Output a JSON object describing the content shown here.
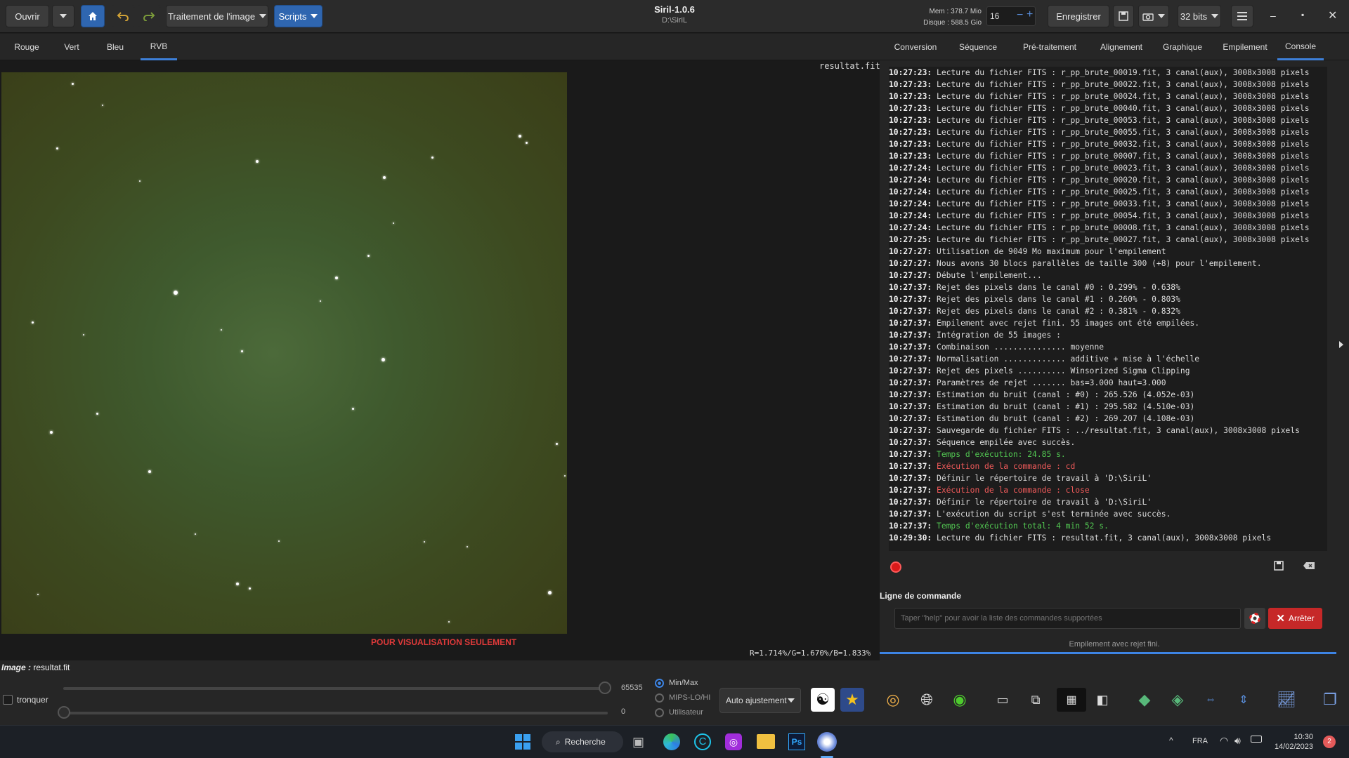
{
  "header": {
    "open_label": "Ouvrir",
    "image_processing_label": "Traitement de l'image",
    "scripts_label": "Scripts",
    "app_title": "Siril-1.0.6",
    "working_dir": "D:\\SiriL",
    "mem": "Mem : 378.7 Mio",
    "disk": "Disque : 588.5 Gio",
    "threads": "16",
    "save_label": "Enregistrer",
    "bits_label": "32 bits"
  },
  "channel_tabs": [
    "Rouge",
    "Vert",
    "Bleu",
    "RVB"
  ],
  "right_tabs": [
    "Conversion",
    "Séquence",
    "Pré-traitement",
    "Alignement",
    "Graphique",
    "Empilement",
    "Console"
  ],
  "image": {
    "filename": "resultat.fit",
    "preview_note": "POUR VISUALISATION SEULEMENT",
    "rgb_readout": "R=1.714%/G=1.670%/B=1.833%",
    "image_label_prefix": "Image :",
    "image_label_value": "resultat.fit"
  },
  "console": {
    "lines": [
      {
        "t": "10:27:23:",
        "m": "Lecture du fichier FITS : r_pp_brute_00019.fit, 3 canal(aux), 3008x3008 pixels",
        "c": ""
      },
      {
        "t": "10:27:23:",
        "m": "Lecture du fichier FITS : r_pp_brute_00022.fit, 3 canal(aux), 3008x3008 pixels",
        "c": ""
      },
      {
        "t": "10:27:23:",
        "m": "Lecture du fichier FITS : r_pp_brute_00024.fit, 3 canal(aux), 3008x3008 pixels",
        "c": ""
      },
      {
        "t": "10:27:23:",
        "m": "Lecture du fichier FITS : r_pp_brute_00040.fit, 3 canal(aux), 3008x3008 pixels",
        "c": ""
      },
      {
        "t": "10:27:23:",
        "m": "Lecture du fichier FITS : r_pp_brute_00053.fit, 3 canal(aux), 3008x3008 pixels",
        "c": ""
      },
      {
        "t": "10:27:23:",
        "m": "Lecture du fichier FITS : r_pp_brute_00055.fit, 3 canal(aux), 3008x3008 pixels",
        "c": ""
      },
      {
        "t": "10:27:23:",
        "m": "Lecture du fichier FITS : r_pp_brute_00032.fit, 3 canal(aux), 3008x3008 pixels",
        "c": ""
      },
      {
        "t": "10:27:23:",
        "m": "Lecture du fichier FITS : r_pp_brute_00007.fit, 3 canal(aux), 3008x3008 pixels",
        "c": ""
      },
      {
        "t": "10:27:24:",
        "m": "Lecture du fichier FITS : r_pp_brute_00023.fit, 3 canal(aux), 3008x3008 pixels",
        "c": ""
      },
      {
        "t": "10:27:24:",
        "m": "Lecture du fichier FITS : r_pp_brute_00020.fit, 3 canal(aux), 3008x3008 pixels",
        "c": ""
      },
      {
        "t": "10:27:24:",
        "m": "Lecture du fichier FITS : r_pp_brute_00025.fit, 3 canal(aux), 3008x3008 pixels",
        "c": ""
      },
      {
        "t": "10:27:24:",
        "m": "Lecture du fichier FITS : r_pp_brute_00033.fit, 3 canal(aux), 3008x3008 pixels",
        "c": ""
      },
      {
        "t": "10:27:24:",
        "m": "Lecture du fichier FITS : r_pp_brute_00054.fit, 3 canal(aux), 3008x3008 pixels",
        "c": ""
      },
      {
        "t": "10:27:24:",
        "m": "Lecture du fichier FITS : r_pp_brute_00008.fit, 3 canal(aux), 3008x3008 pixels",
        "c": ""
      },
      {
        "t": "10:27:25:",
        "m": "Lecture du fichier FITS : r_pp_brute_00027.fit, 3 canal(aux), 3008x3008 pixels",
        "c": ""
      },
      {
        "t": "10:27:27:",
        "m": "Utilisation de 9049 Mo maximum pour l'empilement",
        "c": ""
      },
      {
        "t": "10:27:27:",
        "m": "Nous avons 30 blocs parallèles de taille 300 (+8) pour l'empilement.",
        "c": ""
      },
      {
        "t": "10:27:27:",
        "m": "Débute l'empilement...",
        "c": ""
      },
      {
        "t": "10:27:37:",
        "m": "Rejet des pixels dans le canal #0 : 0.299% - 0.638%",
        "c": ""
      },
      {
        "t": "10:27:37:",
        "m": "Rejet des pixels dans le canal #1 : 0.260% - 0.803%",
        "c": ""
      },
      {
        "t": "10:27:37:",
        "m": "Rejet des pixels dans le canal #2 : 0.381% - 0.832%",
        "c": ""
      },
      {
        "t": "10:27:37:",
        "m": "Empilement avec rejet fini. 55 images ont été empilées.",
        "c": ""
      },
      {
        "t": "10:27:37:",
        "m": "Intégration de 55 images :",
        "c": ""
      },
      {
        "t": "10:27:37:",
        "m": "Combinaison ............... moyenne",
        "c": ""
      },
      {
        "t": "10:27:37:",
        "m": "Normalisation ............. additive + mise à l'échelle",
        "c": ""
      },
      {
        "t": "10:27:37:",
        "m": "Rejet des pixels .......... Winsorized Sigma Clipping",
        "c": ""
      },
      {
        "t": "10:27:37:",
        "m": "Paramètres de rejet ....... bas=3.000 haut=3.000",
        "c": ""
      },
      {
        "t": "10:27:37:",
        "m": "Estimation du bruit (canal : #0) : 265.526 (4.052e-03)",
        "c": ""
      },
      {
        "t": "10:27:37:",
        "m": "Estimation du bruit (canal : #1) : 295.582 (4.510e-03)",
        "c": ""
      },
      {
        "t": "10:27:37:",
        "m": "Estimation du bruit (canal : #2) : 269.207 (4.108e-03)",
        "c": ""
      },
      {
        "t": "10:27:37:",
        "m": "Sauvegarde du fichier FITS : ../resultat.fit, 3 canal(aux), 3008x3008 pixels",
        "c": ""
      },
      {
        "t": "10:27:37:",
        "m": "Séquence empilée avec succès.",
        "c": ""
      },
      {
        "t": "10:27:37:",
        "m": "Temps d'exécution: 24.85 s.",
        "c": "green"
      },
      {
        "t": "10:27:37:",
        "m": "Exécution de la commande : cd",
        "c": "red"
      },
      {
        "t": "10:27:37:",
        "m": "Définir le répertoire de travail à 'D:\\SiriL'",
        "c": ""
      },
      {
        "t": "10:27:37:",
        "m": "Exécution de la commande : close",
        "c": "red"
      },
      {
        "t": "10:27:37:",
        "m": "Définir le répertoire de travail à 'D:\\SiriL'",
        "c": ""
      },
      {
        "t": "10:27:37:",
        "m": "L'exécution du script s'est terminée avec succès.",
        "c": ""
      },
      {
        "t": "10:27:37:",
        "m": "Temps d'exécution total: 4 min 52 s.",
        "c": "green"
      },
      {
        "t": "10:29:30:",
        "m": "Lecture du fichier FITS : resultat.fit, 3 canal(aux), 3008x3008 pixels",
        "c": ""
      }
    ]
  },
  "command": {
    "section_label": "Ligne de commande",
    "placeholder": "Taper \"help\" pour avoir la liste des commandes supportées",
    "stop_label": "Arrêter",
    "status": "Empilement avec rejet fini."
  },
  "display": {
    "truncate_label": "tronquer",
    "high_value": "65535",
    "low_value": "0",
    "radio_options": [
      "Min/Max",
      "MIPS-LO/HI",
      "Utilisateur"
    ],
    "selected_radio": "Min/Max",
    "stretch_mode": "Auto ajustement"
  },
  "taskbar": {
    "search_label": "Recherche",
    "language": "FRA",
    "time": "10:30",
    "date": "14/02/2023",
    "notifications": "2",
    "ps_label": "Ps"
  }
}
